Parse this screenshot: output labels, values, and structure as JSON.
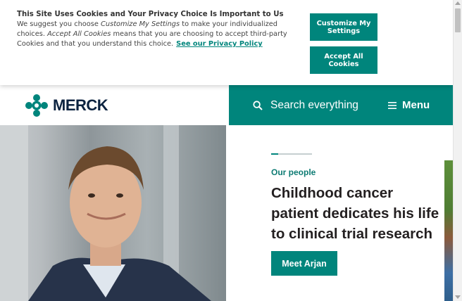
{
  "cookie_banner": {
    "title": "This Site Uses Cookies and Your Privacy Choice Is Important to Us",
    "body_1": "We suggest you choose ",
    "body_em_1": "Customize My Settings",
    "body_2": " to make your individualized choices. ",
    "body_em_2": "Accept All Cookies",
    "body_3": " means that you are choosing to accept third-party Cookies and that you understand this choice.",
    "policy_link": "See our Privacy Policy",
    "customize_button": "Customize My Settings",
    "accept_button": "Accept All Cookies"
  },
  "header": {
    "logo_text": "MERCK",
    "search_label": "Search everything",
    "menu_label": "Menu"
  },
  "hero": {
    "kicker": "Our people",
    "title": "Childhood cancer patient dedicates his life to clinical trial research",
    "cta": "Meet Arjan"
  },
  "colors": {
    "brand_teal": "#00857c",
    "text_dark": "#231f20",
    "logo_navy": "#0c2340"
  },
  "icons": {
    "logo": "merck-logo-icon",
    "search": "search-icon",
    "menu": "hamburger-menu-icon"
  }
}
